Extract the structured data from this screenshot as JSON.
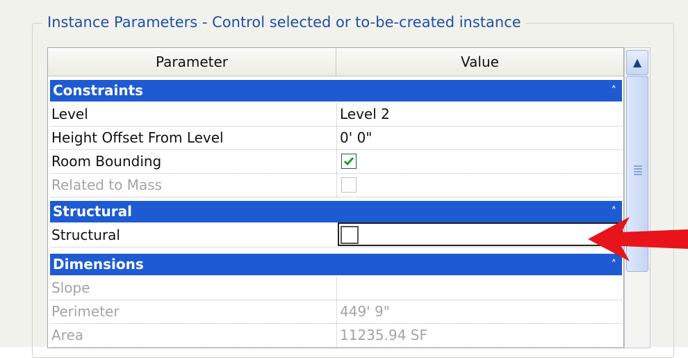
{
  "group": {
    "title": "Instance Parameters - Control selected or to-be-created instance"
  },
  "table": {
    "col_parameter": "Parameter",
    "col_value": "Value",
    "categories": [
      {
        "label": "Constraints",
        "collapse_icon": "double-chevron-up"
      },
      {
        "label": "Structural",
        "collapse_icon": "double-chevron-up"
      },
      {
        "label": "Dimensions",
        "collapse_icon": "double-chevron-up"
      }
    ],
    "constraints": [
      {
        "param": "Level",
        "value": "Level 2"
      },
      {
        "param": "Height Offset From Level",
        "value": "0'  0\""
      },
      {
        "param": "Room Bounding",
        "checked": true
      },
      {
        "param": "Related to Mass",
        "checked": false,
        "disabled": true
      }
    ],
    "structural": [
      {
        "param": "Structural",
        "checked": false,
        "editing": true
      }
    ],
    "dimensions": [
      {
        "param": "Slope",
        "value": "",
        "disabled": true
      },
      {
        "param": "Perimeter",
        "value": "449'  9\"",
        "disabled": true
      },
      {
        "param": "Area",
        "value": "11235.94 SF",
        "disabled": true
      }
    ]
  },
  "colors": {
    "category_bg": "#1e5bd3",
    "arrow": "#e8141b",
    "title": "#1f4fa8"
  }
}
